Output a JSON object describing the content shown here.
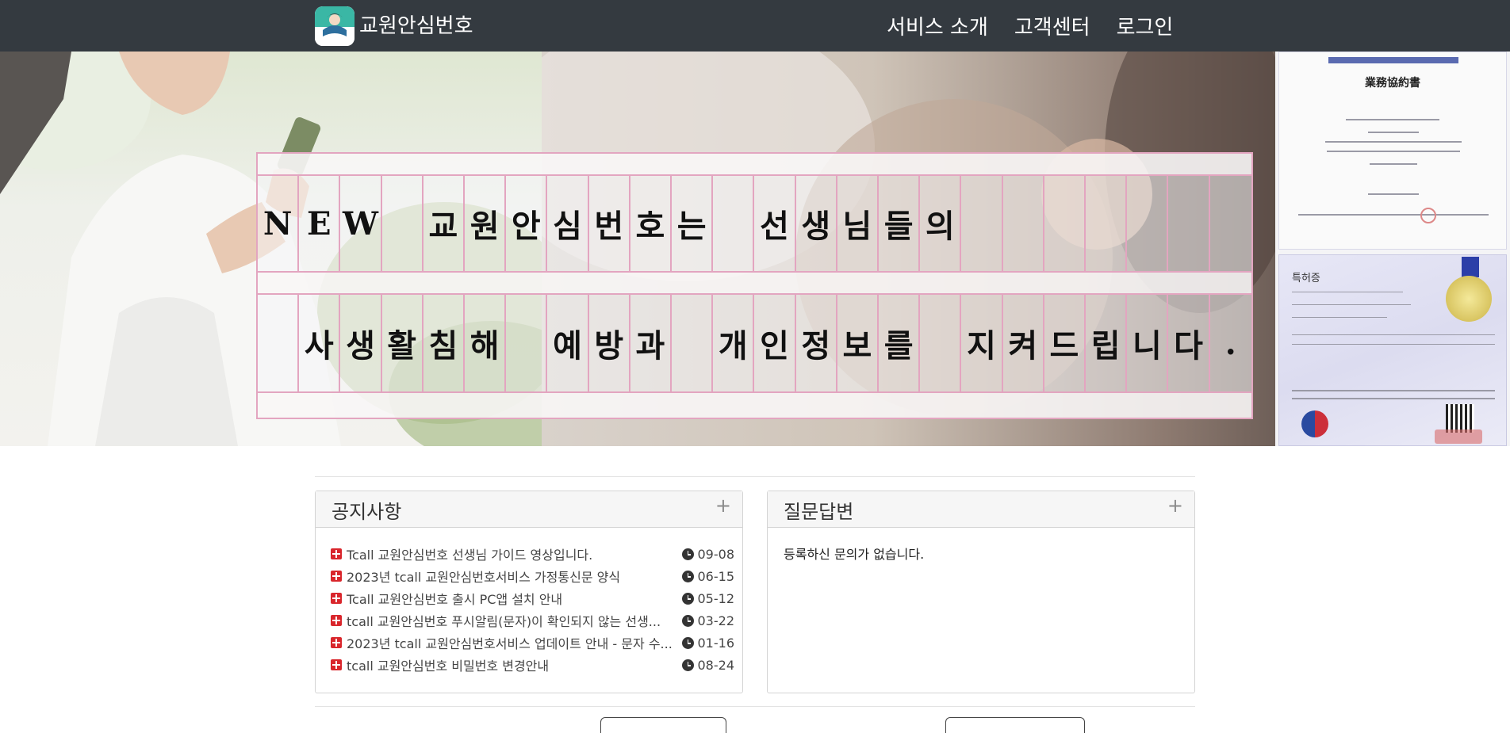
{
  "nav": {
    "brand_title": "교원안심번호",
    "links": [
      "서비스 소개",
      "고객센터",
      "로그인"
    ]
  },
  "hero": {
    "row1": [
      "N",
      "E",
      "W",
      "",
      "교",
      "원",
      "안",
      "심",
      "번",
      "호",
      "는",
      "",
      "선",
      "생",
      "님",
      "들",
      "의",
      "",
      "",
      "",
      "",
      "",
      "",
      ""
    ],
    "row2": [
      "사",
      "생",
      "활",
      "침",
      "해",
      "",
      "예",
      "방",
      "과",
      "",
      "개",
      "인",
      "정",
      "보",
      "를",
      "",
      "지",
      "켜",
      "드",
      "립",
      "니",
      "다",
      "."
    ],
    "certificate_title": "業務協約書",
    "patent_title": "특허증"
  },
  "notice": {
    "title": "공지사항",
    "plus": "+",
    "items": [
      {
        "text": "Tcall 교원안심번호 선생님 가이드 영상입니다.",
        "date": "09-08"
      },
      {
        "text": "2023년 tcall 교원안심번호서비스 가정통신문 양식",
        "date": "06-15"
      },
      {
        "text": "Tcall 교원안심번호 출시 PC앱 설치 안내",
        "date": "05-12"
      },
      {
        "text": "tcall 교원안심번호 푸시알림(문자)이 확인되지 않는 선생...",
        "date": "03-22"
      },
      {
        "text": "2023년 tcall 교원안심번호서비스 업데이트 안내 - 문자 수...",
        "date": "01-16"
      },
      {
        "text": "tcall 교원안심번호 비밀번호 변경안내",
        "date": "08-24"
      }
    ]
  },
  "qa": {
    "title": "질문답변",
    "plus": "+",
    "empty_text": "등록하신 문의가 없습니다."
  },
  "colors": {
    "navbar": "#343a40",
    "grid_line": "#e3a5c0",
    "notice_bullet": "#d9262c"
  }
}
